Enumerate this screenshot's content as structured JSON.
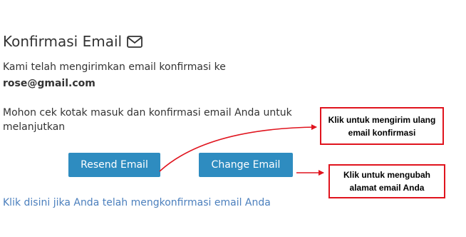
{
  "header": {
    "title": "Konfirmasi Email",
    "icon": "envelope-icon"
  },
  "message": {
    "sent_text": "Kami telah mengirimkan email konfirmasi ke",
    "email": "rose@gmail.com",
    "instruction_line1": "Mohon cek kotak masuk dan konfirmasi email Anda untuk",
    "instruction_line2": "melanjutkan"
  },
  "buttons": {
    "resend_label": "Resend Email",
    "change_label": "Change Email"
  },
  "link": {
    "confirmed_text": "Klik disini jika Anda telah mengkonfirmasi email Anda"
  },
  "annotations": {
    "resend_note_line1": "Klik untuk mengirim ulang",
    "resend_note_line2": "email konfirmasi",
    "change_note_line1": "Klik untuk mengubah",
    "change_note_line2": "alamat email Anda"
  },
  "colors": {
    "button": "#2e8cc0",
    "link": "#4b7fbd",
    "annotation": "#e0141e"
  }
}
